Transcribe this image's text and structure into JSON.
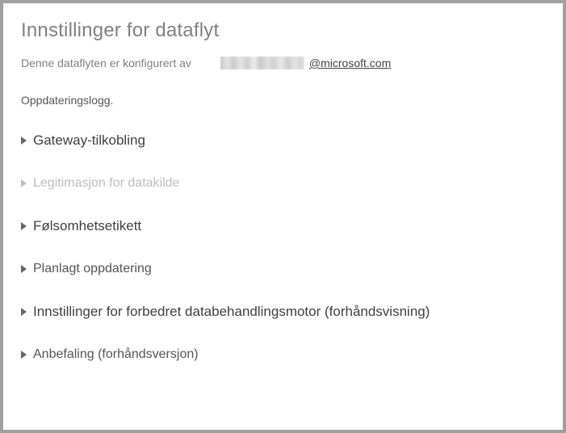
{
  "title": "Innstillinger for dataflyt",
  "config_line": {
    "prefix": "Denne dataflyten er konfigurert av",
    "email_domain": "@microsoft.com"
  },
  "refresh_history": "Oppdateringslogg.",
  "sections": [
    {
      "label": "Gateway-tilkobling",
      "emphasized": true,
      "disabled": false
    },
    {
      "label": "Legitimasjon for datakilde",
      "emphasized": false,
      "disabled": true
    },
    {
      "label": "Følsomhetsetikett",
      "emphasized": true,
      "disabled": false
    },
    {
      "label": "Planlagt oppdatering",
      "emphasized": false,
      "disabled": false
    },
    {
      "label": "Innstillinger for forbedret databehandlingsmotor (forhåndsvisning)",
      "emphasized": true,
      "disabled": false
    },
    {
      "label": "Anbefaling (forhåndsversjon)",
      "emphasized": false,
      "disabled": false
    }
  ]
}
